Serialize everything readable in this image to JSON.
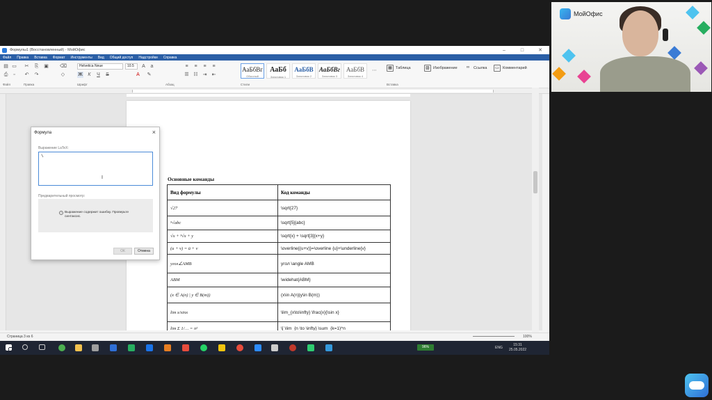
{
  "window": {
    "title": "Формулы1 (Восстановленный) - МойОфис",
    "controls": [
      "–",
      "□",
      "✕"
    ]
  },
  "menu": [
    "Файл",
    "Правка",
    "Вставка",
    "Формат",
    "Инструменты",
    "Вид",
    "Общий доступ",
    "Надстройки",
    "Справка"
  ],
  "ribbon": {
    "font_name": "Helvetica Neue",
    "font_size": "10.5",
    "groups": [
      "Файл",
      "Правка",
      "Шрифт",
      "Абзац",
      "Стили",
      "Вставка"
    ],
    "styles": [
      {
        "sample": "АаБбВг",
        "name": "Обычный"
      },
      {
        "sample": "АаБб",
        "name": "Заголовок 1"
      },
      {
        "sample": "АаБбВ",
        "name": "Заголовок 2"
      },
      {
        "sample": "АаБбВг",
        "name": "Заголовок 3"
      },
      {
        "sample": "АаБбВ",
        "name": "Заголовок 4"
      }
    ],
    "insert_tools": [
      "Таблица",
      "Изображение",
      "Ссылка",
      "Комментарий"
    ]
  },
  "document": {
    "heading": "Основные команды",
    "columns": [
      "Вид формулы",
      "Код команды"
    ],
    "rows": [
      {
        "formula": "√27",
        "code": "\\sqrt{27}"
      },
      {
        "formula": "⁵√abc",
        "code": "\\sqrt[5]{abc}"
      },
      {
        "formula": "√x + ³√x + y",
        "code": "\\sqrt{x} + \\sqrt[3]{x+y}"
      },
      {
        "formula": "(u + v) = ū + v",
        "code": "\\overline{(u+v)}=\\overline {u}+\\underline{v}"
      },
      {
        "formula": "угол∠AMB",
        "code": "угол \\angle AMB"
      },
      {
        "formula": "ABM",
        "code": "\\widehat{ABM}"
      },
      {
        "formula": "(x ∈ A(n) | y ∈ B(m))",
        "code": "(x\\in A(n)|y\\in B(m))"
      },
      {
        "formula": "lim x/sinx",
        "code": "\\lim_{x\\to\\infty} \\frac{x}{\\sin x}"
      },
      {
        "formula": "lim Σ 1/… = π²",
        "code": "\\[ \\lim_{n \\to \\infty} \\sum_{k=1}^n"
      }
    ]
  },
  "dialog": {
    "title": "Формула",
    "latex_label": "Выражение LaTeX:",
    "latex_value": "\\",
    "preview_label": "Предварительный просмотр:",
    "error_text": "Выражение содержит ошибку. Проверьте синтаксис.",
    "ok_label": "ОК",
    "cancel_label": "Отмена"
  },
  "status": {
    "page": "Страница 3 из 6",
    "zoom": "100%"
  },
  "taskbar": {
    "battery": "96%",
    "lang": "ENG",
    "time": "15:31",
    "date": "25.05.2022"
  },
  "webcam": {
    "brand": "МойОфис"
  }
}
